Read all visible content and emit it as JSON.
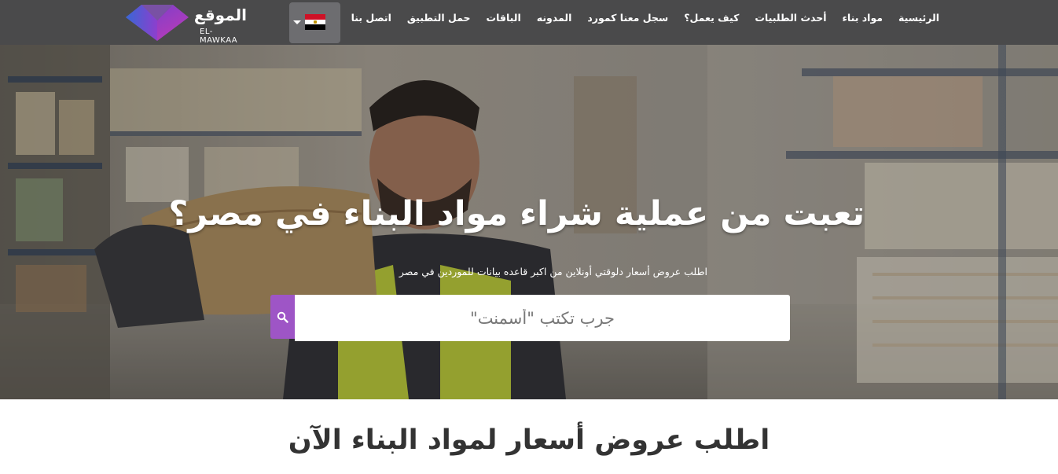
{
  "brand": {
    "name_ar": "الموقع",
    "name_en": "EL-MAWKAA",
    "accent_color": "#9e55c6",
    "nav_bg": "#4a4a4b"
  },
  "language_selector": {
    "flag": "egypt-flag-icon",
    "caret": "caret-down-icon"
  },
  "nav": {
    "items": [
      {
        "label": "الرئيسية"
      },
      {
        "label": "مواد بناء"
      },
      {
        "label": "أحدث الطلبيات"
      },
      {
        "label": "كيف يعمل؟"
      },
      {
        "label": "سجل معنا كمورد"
      },
      {
        "label": "المدونه"
      },
      {
        "label": "الباقات"
      },
      {
        "label": "حمل التطبيق"
      },
      {
        "label": "اتصل بنا"
      }
    ]
  },
  "hero": {
    "headline": "تعبت من عملية شراء مواد البناء في مصر؟",
    "subheadline": "اطلب عروض أسعار دلوقتي أونلاين من اكبر قاعده بيانات للموردين في مصر",
    "search": {
      "placeholder": "جرب تكتب \"أسمنت\"",
      "value": "",
      "button_icon": "search-icon"
    }
  },
  "section": {
    "title": "اطلب عروض أسعار لمواد البناء الآن"
  }
}
